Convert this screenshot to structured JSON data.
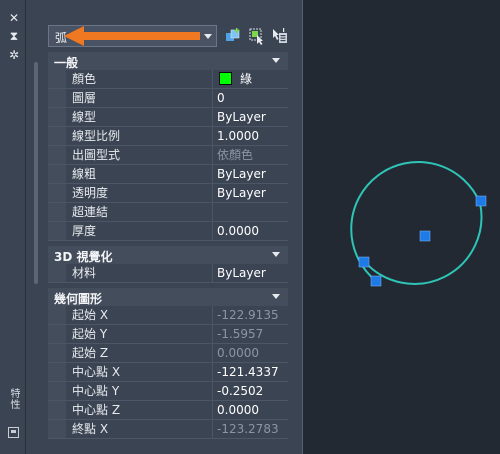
{
  "palette": {
    "side_title": "特性",
    "object_type": "弧"
  },
  "toolbar": {
    "buttons": [
      "quick-select-icon",
      "select-objects-icon",
      "toggle-pickadd-icon"
    ]
  },
  "sections": {
    "general": {
      "title": "一般",
      "rows": [
        {
          "label": "顏色",
          "value": "綠"
        },
        {
          "label": "圖層",
          "value": "0"
        },
        {
          "label": "線型",
          "value": "ByLayer"
        },
        {
          "label": "線型比例",
          "value": "1.0000"
        },
        {
          "label": "出圖型式",
          "value": "依顏色"
        },
        {
          "label": "線粗",
          "value": "ByLayer"
        },
        {
          "label": "透明度",
          "value": "ByLayer"
        },
        {
          "label": "超連結",
          "value": ""
        },
        {
          "label": "厚度",
          "value": "0.0000"
        }
      ]
    },
    "visual3d": {
      "title": "3D 視覺化",
      "rows": [
        {
          "label": "材料",
          "value": "ByLayer"
        }
      ]
    },
    "geometry": {
      "title": "幾何圖形",
      "rows": [
        {
          "label": "起始 X",
          "value": "-122.9135"
        },
        {
          "label": "起始 Y",
          "value": "-1.5957"
        },
        {
          "label": "起始 Z",
          "value": "0.0000"
        },
        {
          "label": "中心點 X",
          "value": "-121.4337"
        },
        {
          "label": "中心點 Y",
          "value": "-0.2502"
        },
        {
          "label": "中心點 Z",
          "value": "0.0000"
        },
        {
          "label": "終點 X",
          "value": "-123.2783"
        }
      ]
    }
  },
  "colors": {
    "arc": "#2ec4b6",
    "grip": "#1e7ae6",
    "annotation_arrow": "#f07820",
    "swatch_green": "#00ff00"
  }
}
